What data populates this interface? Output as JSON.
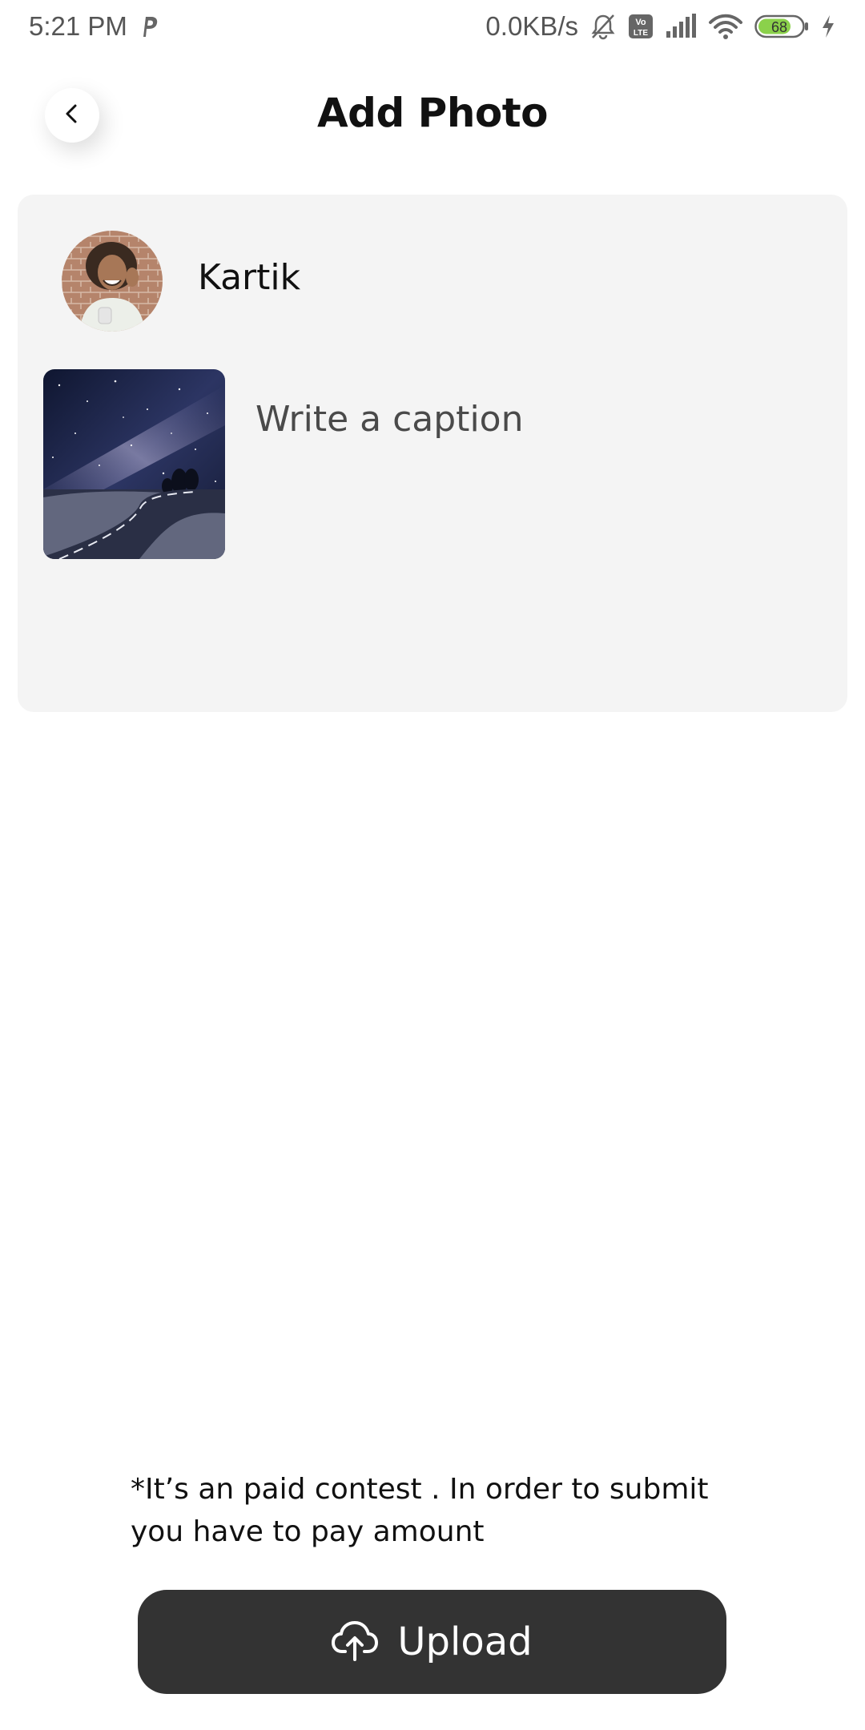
{
  "status_bar": {
    "time": "5:21 PM",
    "network_speed": "0.0KB/s",
    "battery_level": "68",
    "icons": [
      "parking-icon",
      "mute-bell-icon",
      "volte-icon",
      "signal-icon",
      "wifi-icon",
      "battery-icon",
      "charging-icon"
    ]
  },
  "header": {
    "title": "Add Photo",
    "back_icon": "chevron-left-icon"
  },
  "post": {
    "user_name": "Kartik",
    "caption_placeholder": "Write a caption",
    "caption_value": ""
  },
  "footer": {
    "notice": "*It’s an paid contest . In order to submit you have to pay amount",
    "upload_label": "Upload",
    "upload_icon": "cloud-upload-icon"
  },
  "colors": {
    "card_bg": "#f4f4f4",
    "button_bg": "#333333",
    "battery_fill": "#8bd14b"
  }
}
